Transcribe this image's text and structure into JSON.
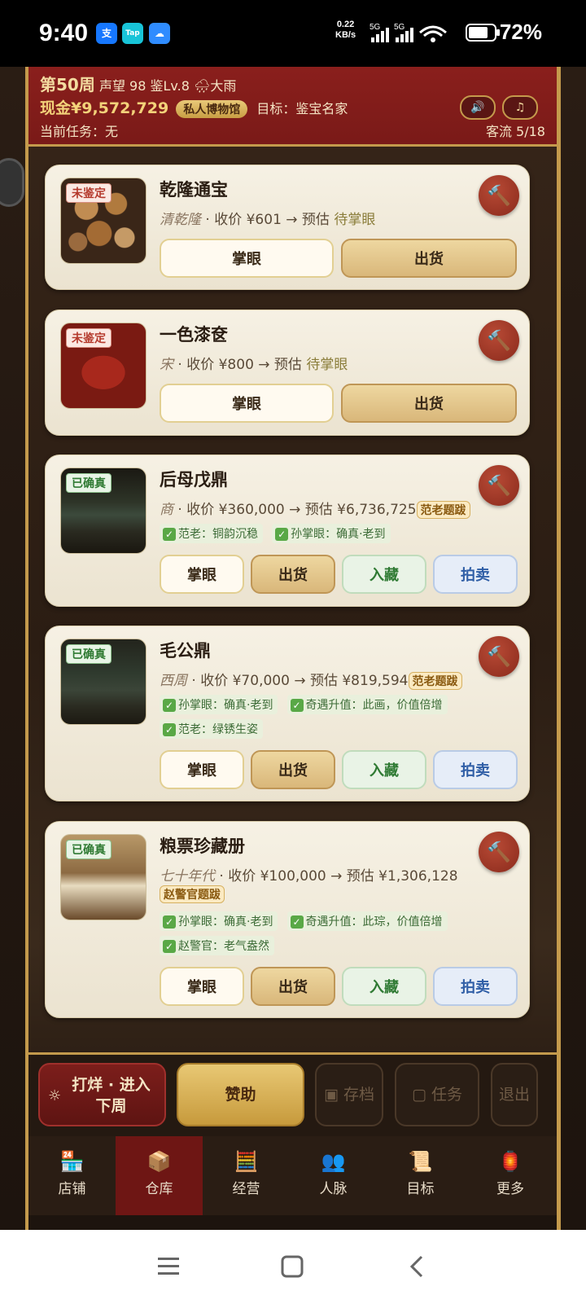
{
  "status": {
    "time": "9:40",
    "apps": [
      "支",
      "Tap",
      "☁"
    ],
    "speed_top": "0.22",
    "speed_unit": "KB/s",
    "battery": "72%"
  },
  "header": {
    "week": "第50周",
    "reputation": "声望 98",
    "appraise_level": "鉴Lv.8",
    "weather": "🌧大雨",
    "cash_label": "现金",
    "cash": "¥9,572,729",
    "museum_badge": "私人博物馆",
    "goal": "目标：鉴宝名家",
    "task": "当前任务：无",
    "flow": "客流 5/18",
    "sound_icon": "🔊",
    "music_icon": "♫"
  },
  "items": [
    {
      "name": "乾隆通宝",
      "tag": "未鉴定",
      "era": "清乾隆",
      "info": " · 收价 ¥601 → 预估 ",
      "estimate": "待掌眼",
      "badge": "",
      "chips": [],
      "buttons": [
        "掌眼",
        "出货"
      ]
    },
    {
      "name": "一色漆奁",
      "tag": "未鉴定",
      "era": "宋",
      "info": " · 收价 ¥800 → 预估 ",
      "estimate": "待掌眼",
      "badge": "",
      "chips": [],
      "buttons": [
        "掌眼",
        "出货"
      ]
    },
    {
      "name": "后母戊鼎",
      "tag": "已确真",
      "era": "商",
      "info": " · 收价 ¥360,000 → 预估 ¥6,736,725",
      "estimate": "",
      "badge": "范老题跋",
      "chips": [
        "范老：铜韵沉稳",
        "孙掌眼：确真·老到"
      ],
      "buttons": [
        "掌眼",
        "出货",
        "入藏",
        "拍卖"
      ]
    },
    {
      "name": "毛公鼎",
      "tag": "已确真",
      "era": "西周",
      "info": " · 收价 ¥70,000 → 预估 ¥819,594",
      "estimate": "",
      "badge": "范老题跋",
      "chips": [
        "孙掌眼：确真·老到",
        "奇遇升值：此画，价值倍增",
        "范老：绿锈生姿"
      ],
      "buttons": [
        "掌眼",
        "出货",
        "入藏",
        "拍卖"
      ]
    },
    {
      "name": "粮票珍藏册",
      "tag": "已确真",
      "era": "七十年代",
      "info": " · 收价 ¥100,000 → 预估 ¥1,306,128",
      "estimate": "",
      "badge": "赵警官题跋",
      "chips": [
        "孙掌眼：确真·老到",
        "奇遇升值：此琮，价值倍增",
        "赵警官：老气盎然"
      ],
      "buttons": [
        "掌眼",
        "出货",
        "入藏",
        "拍卖"
      ]
    }
  ],
  "actions": {
    "next_week_line1": "打烊 · 进入",
    "next_week_line2": "下周",
    "sponsor": "赞助",
    "save": "存档",
    "tasks": "任务",
    "quit": "退出"
  },
  "nav": [
    {
      "label": "店铺",
      "icon": "🏪"
    },
    {
      "label": "仓库",
      "icon": "📦"
    },
    {
      "label": "经营",
      "icon": "🧮"
    },
    {
      "label": "人脉",
      "icon": "👥"
    },
    {
      "label": "目标",
      "icon": "📜"
    },
    {
      "label": "更多",
      "icon": "🏮"
    }
  ],
  "colors": {
    "accent_red": "#8a1f1c",
    "gold": "#c49a4c",
    "confirmed_green": "#2f7a33",
    "auction_blue": "#2f5ea6"
  }
}
